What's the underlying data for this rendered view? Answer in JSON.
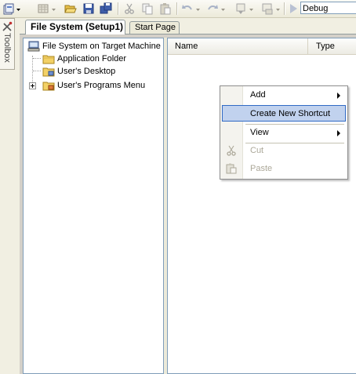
{
  "toolbar": {
    "config_value": "Debug",
    "icons": [
      "new-project-icon",
      "add-item-icon",
      "open-icon",
      "save-icon",
      "save-all-icon",
      "cut-icon",
      "copy-icon",
      "paste-icon",
      "undo-icon",
      "redo-icon",
      "navigate-icon",
      "publish-icon",
      "start-icon"
    ]
  },
  "toolbox": {
    "label": "Toolbox"
  },
  "tabs": [
    {
      "label": "File System (Setup1)",
      "active": true
    },
    {
      "label": "Start Page",
      "active": false
    }
  ],
  "tree": {
    "root": "File System on Target Machine",
    "children": [
      {
        "label": "Application Folder"
      },
      {
        "label": "User's Desktop"
      },
      {
        "label": "User's Programs Menu",
        "collapsed": true
      }
    ]
  },
  "list": {
    "columns": [
      "Name",
      "Type"
    ]
  },
  "context_menu": {
    "items": [
      {
        "label": "Add",
        "submenu": true,
        "enabled": true
      },
      {
        "label": "Create New Shortcut",
        "submenu": false,
        "enabled": true,
        "highlighted": true
      },
      {
        "label": "View",
        "submenu": true,
        "enabled": true
      },
      {
        "label": "Cut",
        "submenu": false,
        "enabled": false
      },
      {
        "label": "Paste",
        "submenu": false,
        "enabled": false
      }
    ]
  },
  "colors": {
    "highlight_fill": "#c1d2ee",
    "highlight_border": "#316ac5",
    "disabled_text": "#aca899",
    "folder": "#f3d166"
  }
}
